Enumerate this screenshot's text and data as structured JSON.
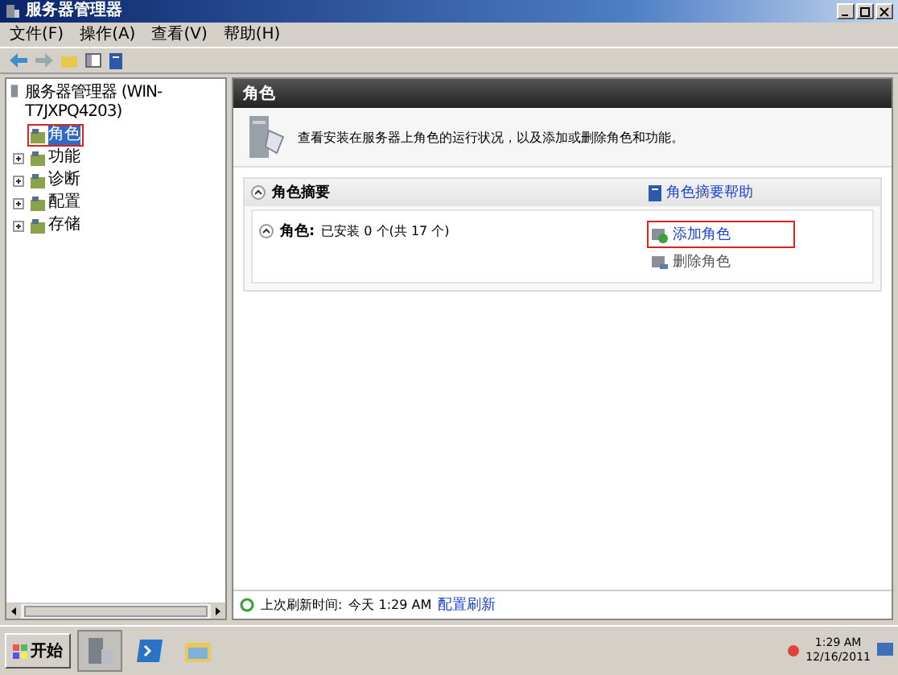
{
  "window": {
    "title": "服务器管理器"
  },
  "menu": [
    "文件(F)",
    "操作(A)",
    "查看(V)",
    "帮助(H)"
  ],
  "tree": [
    {
      "label": "服务器管理器 (WIN-T7JXPQ4203)",
      "selected": false,
      "highlighted": false,
      "children": [
        {
          "label": "角色",
          "selected": true,
          "highlighted": true,
          "expandable": false
        },
        {
          "label": "功能",
          "selected": false,
          "highlighted": false,
          "expandable": true
        },
        {
          "label": "诊断",
          "selected": false,
          "highlighted": false,
          "expandable": true
        },
        {
          "label": "配置",
          "selected": false,
          "highlighted": false,
          "expandable": true
        },
        {
          "label": "存储",
          "selected": false,
          "highlighted": false,
          "expandable": true
        }
      ]
    }
  ],
  "content": {
    "header": "角色",
    "description": "查看安装在服务器上角色的运行状况，以及添加或删除角色和功能。",
    "section": {
      "title": "角色摘要",
      "help_link": "角色摘要帮助",
      "roles_label": "角色:",
      "roles_status": "已安装 0 个(共 17 个)",
      "tasks": [
        {
          "label": "添加角色",
          "kind": "add",
          "highlighted": true
        },
        {
          "label": "删除角色",
          "kind": "remove",
          "highlighted": false
        }
      ]
    }
  },
  "status": {
    "label": "上次刷新时间:",
    "time": "今天 1:29 AM",
    "link": "配置刷新"
  },
  "taskbar": {
    "start": "开始",
    "time": "1:29 AM",
    "date": "12/16/2011"
  }
}
